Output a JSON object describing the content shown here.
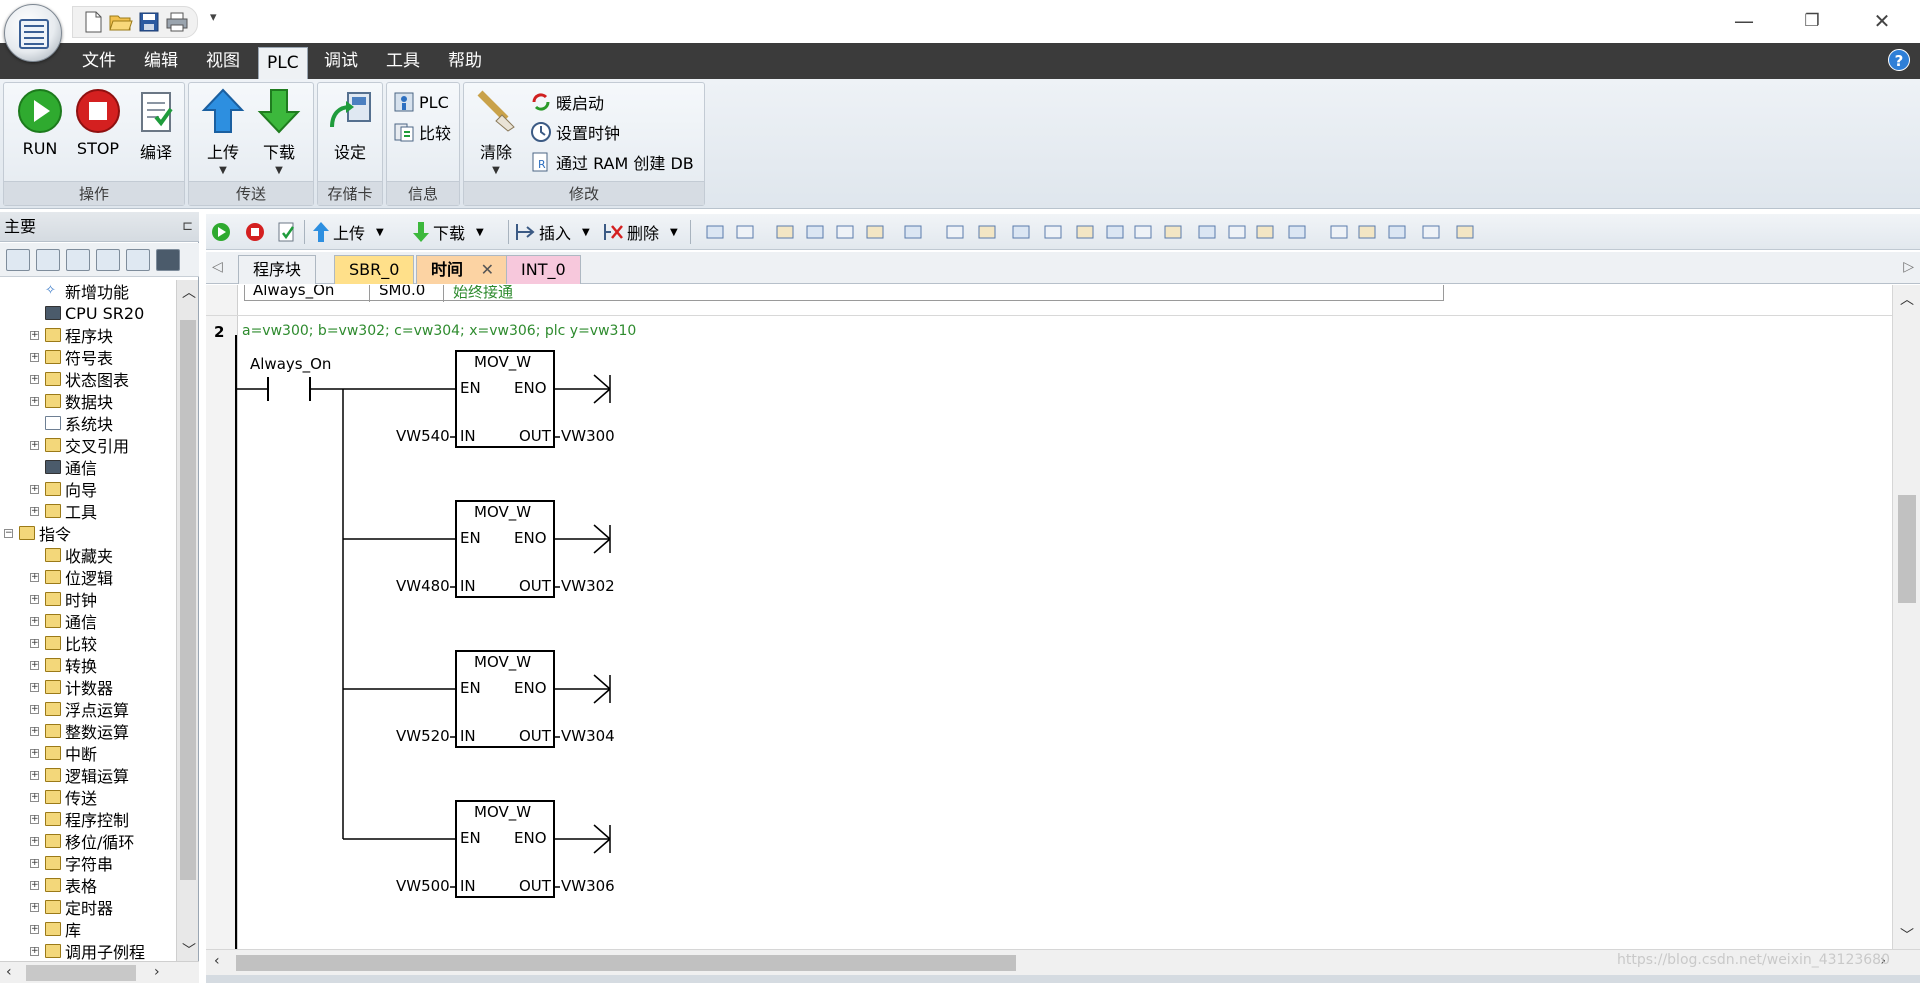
{
  "quick_access": {
    "icons": [
      "new-file-icon",
      "open-folder-icon",
      "save-icon",
      "print-icon"
    ],
    "overflow": "▾"
  },
  "window_controls": {
    "minimize": "—",
    "restore": "❐",
    "close": "✕"
  },
  "menu": {
    "items": [
      "文件",
      "编辑",
      "视图",
      "PLC",
      "调试",
      "工具",
      "帮助"
    ],
    "active": "PLC",
    "help": "?"
  },
  "ribbon": {
    "groups": [
      {
        "label": "操作",
        "buttons": [
          "RUN",
          "STOP",
          "编译"
        ]
      },
      {
        "label": "传送",
        "buttons": [
          "上传",
          "下载"
        ]
      },
      {
        "label": "存储卡",
        "buttons": [
          "设定"
        ]
      },
      {
        "label": "信息",
        "buttons": [
          "PLC",
          "比较"
        ]
      },
      {
        "label": "修改",
        "buttons": [
          "清除",
          "暖启动",
          "设置时钟",
          "通过 RAM 创建 DB"
        ]
      }
    ]
  },
  "left_panel": {
    "title": "主要",
    "pin": "⊏",
    "tree": [
      {
        "label": "新增功能",
        "depth": 2,
        "expander": "",
        "icon": "new"
      },
      {
        "label": "CPU SR20",
        "depth": 2,
        "expander": "",
        "icon": "cpu"
      },
      {
        "label": "程序块",
        "depth": 1,
        "expander": "+",
        "icon": "folder"
      },
      {
        "label": "符号表",
        "depth": 1,
        "expander": "+",
        "icon": "folder"
      },
      {
        "label": "状态图表",
        "depth": 1,
        "expander": "+",
        "icon": "folder"
      },
      {
        "label": "数据块",
        "depth": 1,
        "expander": "+",
        "icon": "folder"
      },
      {
        "label": "系统块",
        "depth": 2,
        "expander": "",
        "icon": "doc"
      },
      {
        "label": "交叉引用",
        "depth": 1,
        "expander": "+",
        "icon": "folder"
      },
      {
        "label": "通信",
        "depth": 2,
        "expander": "",
        "icon": "cpu"
      },
      {
        "label": "向导",
        "depth": 1,
        "expander": "+",
        "icon": "folder"
      },
      {
        "label": "工具",
        "depth": 1,
        "expander": "+",
        "icon": "folder"
      },
      {
        "label": "指令",
        "depth": 0,
        "expander": "−",
        "icon": "folder"
      },
      {
        "label": "收藏夹",
        "depth": 2,
        "expander": "",
        "icon": "folder"
      },
      {
        "label": "位逻辑",
        "depth": 1,
        "expander": "+",
        "icon": "folder"
      },
      {
        "label": "时钟",
        "depth": 1,
        "expander": "+",
        "icon": "folder"
      },
      {
        "label": "通信",
        "depth": 1,
        "expander": "+",
        "icon": "folder"
      },
      {
        "label": "比较",
        "depth": 1,
        "expander": "+",
        "icon": "folder"
      },
      {
        "label": "转换",
        "depth": 1,
        "expander": "+",
        "icon": "folder"
      },
      {
        "label": "计数器",
        "depth": 1,
        "expander": "+",
        "icon": "folder"
      },
      {
        "label": "浮点运算",
        "depth": 1,
        "expander": "+",
        "icon": "folder"
      },
      {
        "label": "整数运算",
        "depth": 1,
        "expander": "+",
        "icon": "folder"
      },
      {
        "label": "中断",
        "depth": 1,
        "expander": "+",
        "icon": "folder"
      },
      {
        "label": "逻辑运算",
        "depth": 1,
        "expander": "+",
        "icon": "folder"
      },
      {
        "label": "传送",
        "depth": 1,
        "expander": "+",
        "icon": "folder"
      },
      {
        "label": "程序控制",
        "depth": 1,
        "expander": "+",
        "icon": "folder"
      },
      {
        "label": "移位/循环",
        "depth": 1,
        "expander": "+",
        "icon": "folder"
      },
      {
        "label": "字符串",
        "depth": 1,
        "expander": "+",
        "icon": "folder"
      },
      {
        "label": "表格",
        "depth": 1,
        "expander": "+",
        "icon": "folder"
      },
      {
        "label": "定时器",
        "depth": 1,
        "expander": "+",
        "icon": "folder"
      },
      {
        "label": "库",
        "depth": 1,
        "expander": "+",
        "icon": "folder"
      },
      {
        "label": "调用子例程",
        "depth": 1,
        "expander": "+",
        "icon": "folder"
      }
    ]
  },
  "editor_toolbar": {
    "upload": "上传",
    "download": "下载",
    "insert": "插入",
    "delete": "删除"
  },
  "tabs": [
    {
      "label": "程序块",
      "color": "#eef1f4",
      "active": false
    },
    {
      "label": "SBR_0",
      "color": "#ffe08a",
      "active": false
    },
    {
      "label": "时间",
      "color": "#fcd3a3",
      "active": true,
      "close": "✕"
    },
    {
      "label": "INT_0",
      "color": "#f7c8dc",
      "active": false
    }
  ],
  "network1_symbol_row": {
    "symbol": "Always_On",
    "address": "SM0.0",
    "comment": "始终接通"
  },
  "network2": {
    "number": "2",
    "comment": "a=vw300; b=vw302; c=vw304; x=vw306; plc y=vw310",
    "contact": "Always_On",
    "blocks": [
      {
        "name": "MOV_W",
        "en": "EN",
        "eno": "ENO",
        "in_label": "IN",
        "out_label": "OUT",
        "input": "VW540",
        "output": "VW300"
      },
      {
        "name": "MOV_W",
        "en": "EN",
        "eno": "ENO",
        "in_label": "IN",
        "out_label": "OUT",
        "input": "VW480",
        "output": "VW302"
      },
      {
        "name": "MOV_W",
        "en": "EN",
        "eno": "ENO",
        "in_label": "IN",
        "out_label": "OUT",
        "input": "VW520",
        "output": "VW304"
      },
      {
        "name": "MOV_W",
        "en": "EN",
        "eno": "ENO",
        "in_label": "IN",
        "out_label": "OUT",
        "input": "VW500",
        "output": "VW306"
      }
    ]
  },
  "watermark": "https://blog.csdn.net/weixin_43123680",
  "colors": {
    "menubar": "#3b3b3b",
    "comment_green": "#2e8b2e",
    "run_green": "#2faa2f",
    "stop_red": "#d42020"
  }
}
